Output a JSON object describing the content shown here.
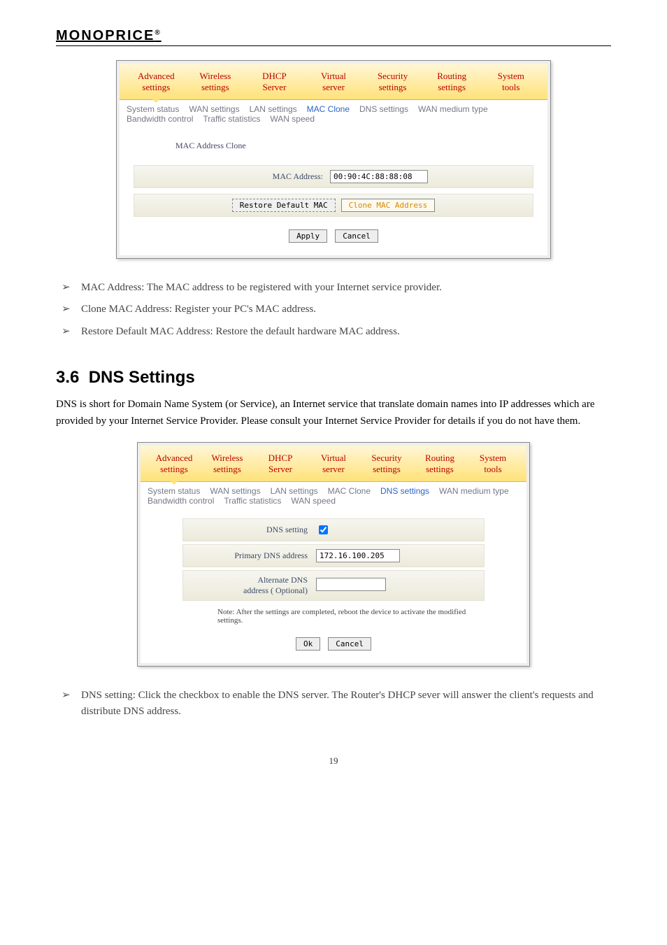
{
  "brand": "MONOPRICE",
  "brand_sup": "®",
  "screenshot1": {
    "tabs": [
      {
        "l1": "Advanced",
        "l2": "settings",
        "active": true
      },
      {
        "l1": "Wireless",
        "l2": "settings"
      },
      {
        "l1": "DHCP",
        "l2": "Server"
      },
      {
        "l1": "Virtual",
        "l2": "server"
      },
      {
        "l1": "Security",
        "l2": "settings"
      },
      {
        "l1": "Routing",
        "l2": "settings"
      },
      {
        "l1": "System",
        "l2": "tools"
      }
    ],
    "subtabs": [
      {
        "label": "System status"
      },
      {
        "label": "WAN settings"
      },
      {
        "label": "LAN settings"
      },
      {
        "label": "MAC Clone",
        "active": true
      },
      {
        "label": "DNS settings"
      },
      {
        "label": "WAN medium type"
      },
      {
        "label": "Bandwidth control"
      },
      {
        "label": "Traffic statistics"
      },
      {
        "label": "WAN speed"
      }
    ],
    "section_title": "MAC Address Clone",
    "mac_label": "MAC Address:",
    "mac_value": "00:90:4C:88:88:08",
    "restore_btn": "Restore Default MAC",
    "clone_btn": "Clone MAC Address",
    "apply_btn": "Apply",
    "cancel_btn": "Cancel"
  },
  "bullets1": [
    "MAC Address: The MAC address to be registered with your Internet service provider.",
    "Clone MAC Address: Register your PC's MAC address.",
    "Restore Default MAC Address: Restore the default hardware MAC address."
  ],
  "section6": {
    "heading_num": "3.6",
    "heading_text": "DNS Settings",
    "para": "DNS is short for Domain Name System (or Service), an Internet service that translate domain names into IP addresses which are provided by your Internet Service Provider. Please consult your Internet Service Provider for details if you do not have them."
  },
  "screenshot2": {
    "tabs": [
      {
        "l1": "Advanced",
        "l2": "settings",
        "active": true
      },
      {
        "l1": "Wireless",
        "l2": "settings"
      },
      {
        "l1": "DHCP",
        "l2": "Server"
      },
      {
        "l1": "Virtual",
        "l2": "server"
      },
      {
        "l1": "Security",
        "l2": "settings"
      },
      {
        "l1": "Routing",
        "l2": "settings"
      },
      {
        "l1": "System",
        "l2": "tools"
      }
    ],
    "subtabs": [
      {
        "label": "System status"
      },
      {
        "label": "WAN settings"
      },
      {
        "label": "LAN settings"
      },
      {
        "label": "MAC Clone"
      },
      {
        "label": "DNS settings",
        "active": true
      },
      {
        "label": "WAN medium type"
      },
      {
        "label": "Bandwidth control"
      },
      {
        "label": "Traffic statistics"
      },
      {
        "label": "WAN speed"
      }
    ],
    "dns_setting_label": "DNS setting",
    "dns_checked": true,
    "primary_label": "Primary DNS address",
    "primary_value": "172.16.100.205",
    "alt_label1": "Alternate DNS",
    "alt_label2": "address ( Optional)",
    "alt_value": "",
    "note": "Note: After the settings are completed, reboot the device to activate the modified settings.",
    "ok_btn": "Ok",
    "cancel_btn": "Cancel"
  },
  "bullets2": [
    "DNS setting: Click the checkbox to enable the DNS server. The Router's DHCP sever will answer the client's requests and distribute DNS address."
  ],
  "page_number": "19"
}
